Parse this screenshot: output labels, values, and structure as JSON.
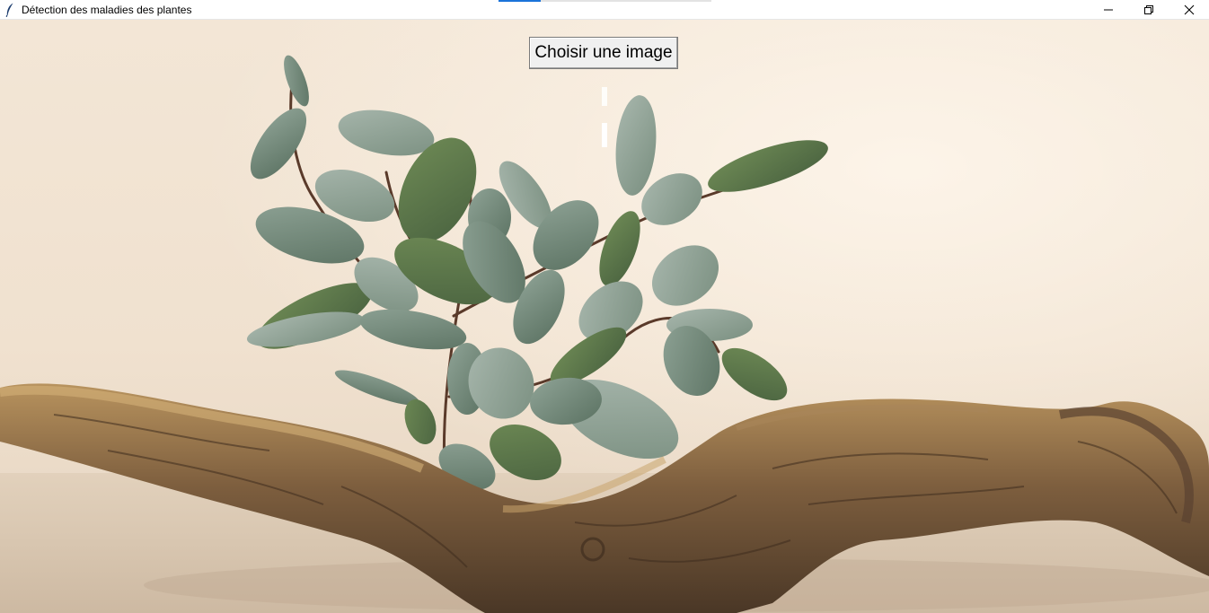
{
  "window": {
    "title": "Détection des maladies des plantes",
    "icon": "feather-icon",
    "controls": [
      "minimize-icon",
      "restore-icon",
      "close-icon"
    ]
  },
  "main": {
    "choose_button_label": "Choisir une image",
    "result_label_1": "",
    "result_label_2": ""
  },
  "colors": {
    "background_wall": "#f0e1cf",
    "button_face": "#f0f0f0",
    "leaf_green": "#6d8474",
    "driftwood": "#8a6a45"
  }
}
